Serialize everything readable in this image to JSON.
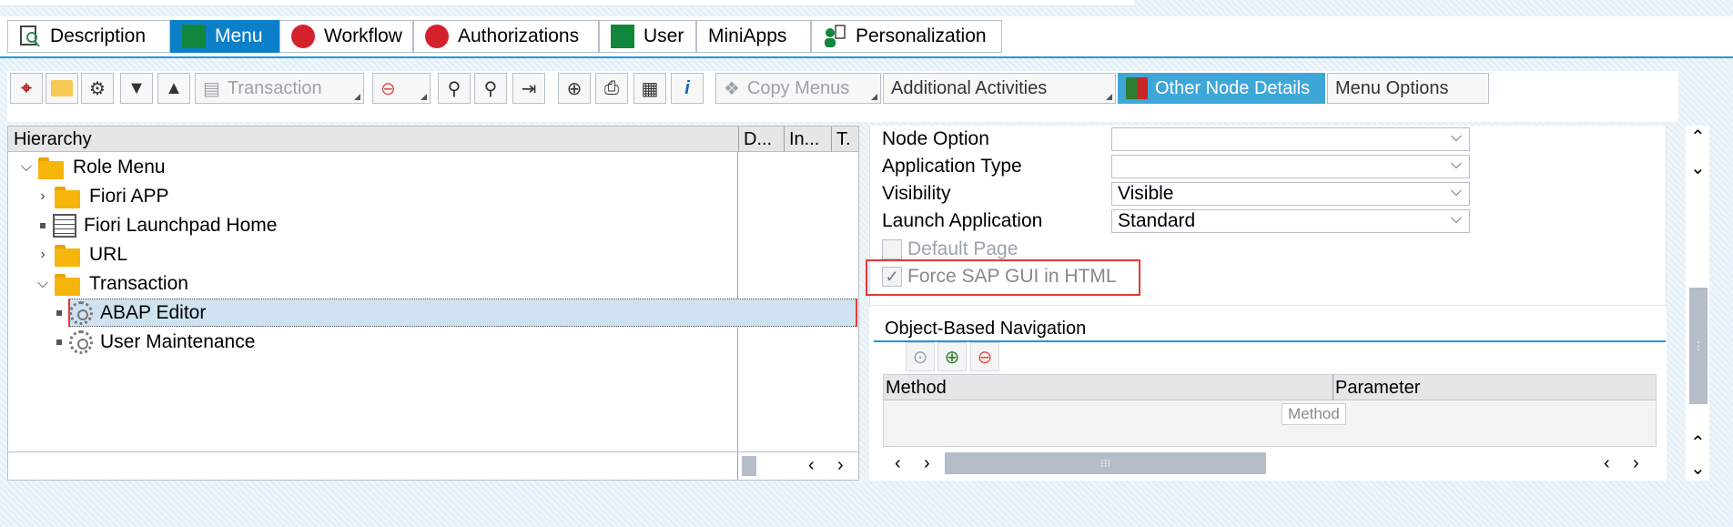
{
  "tabs": [
    {
      "label": "Description",
      "icon": "description-icon"
    },
    {
      "label": "Menu",
      "icon": "menu-icon",
      "active": true
    },
    {
      "label": "Workflow",
      "icon": "workflow-icon"
    },
    {
      "label": "Authorizations",
      "icon": "authorizations-icon"
    },
    {
      "label": "User",
      "icon": "user-icon"
    },
    {
      "label": "MiniApps",
      "icon": ""
    },
    {
      "label": "Personalization",
      "icon": "personalization-icon"
    }
  ],
  "toolbar": {
    "transaction_label": "Transaction",
    "copy_menus_label": "Copy Menus",
    "additional_activities_label": "Additional Activities",
    "other_node_details_label": "Other Node Details",
    "menu_options_label": "Menu Options"
  },
  "hierarchy": {
    "columns": [
      "Hierarchy",
      "D...",
      "In...",
      "T."
    ],
    "nodes": [
      {
        "label": "Role Menu",
        "level": 0,
        "expanded": true,
        "icon": "folder-open-icon"
      },
      {
        "label": "Fiori APP",
        "level": 1,
        "expanded": false,
        "icon": "folder-icon"
      },
      {
        "label": "Fiori Launchpad Home",
        "level": 1,
        "icon": "list-document-icon"
      },
      {
        "label": "URL",
        "level": 1,
        "expanded": false,
        "icon": "folder-icon"
      },
      {
        "label": "Transaction",
        "level": 1,
        "expanded": true,
        "icon": "folder-open-icon"
      },
      {
        "label": "ABAP Editor",
        "level": 2,
        "icon": "transaction-gear-icon",
        "selected": true
      },
      {
        "label": "User Maintenance",
        "level": 2,
        "icon": "transaction-gear-icon"
      }
    ]
  },
  "node_details": {
    "node_option_label": "Node Option",
    "node_option_value": "",
    "application_type_label": "Application Type",
    "application_type_value": "",
    "visibility_label": "Visibility",
    "visibility_value": "Visible",
    "launch_application_label": "Launch Application",
    "launch_application_value": "Standard",
    "default_page_label": "Default Page",
    "default_page_checked": false,
    "force_sapgui_label": "Force SAP GUI in HTML",
    "force_sapgui_checked": true
  },
  "obn": {
    "title": "Object-Based Navigation",
    "columns": [
      "Method",
      "Parameter"
    ],
    "tooltip": "Method"
  },
  "colors": {
    "accent": "#0c7fc9",
    "highlight": "#e53935",
    "selected_row": "#cfe2f0"
  }
}
